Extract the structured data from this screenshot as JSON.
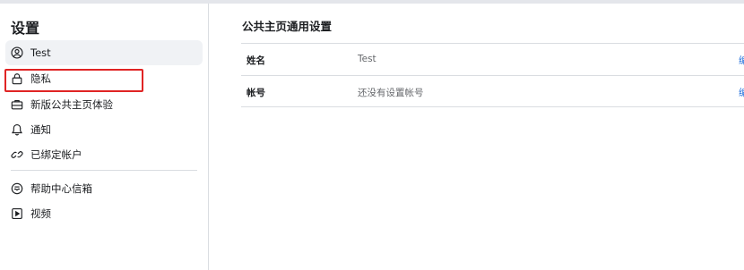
{
  "sidebar": {
    "title": "设置",
    "items": [
      {
        "label": "Test",
        "icon": "user-circle-icon"
      },
      {
        "label": "隐私",
        "icon": "lock-icon"
      },
      {
        "label": "新版公共主页体验",
        "icon": "briefcase-icon"
      },
      {
        "label": "通知",
        "icon": "bell-icon"
      },
      {
        "label": "已绑定帐户",
        "icon": "link-icon"
      },
      {
        "label": "帮助中心信箱",
        "icon": "inbox-icon"
      },
      {
        "label": "视频",
        "icon": "play-video-icon"
      }
    ]
  },
  "main": {
    "title": "公共主页通用设置",
    "rows": [
      {
        "label": "姓名",
        "value": "Test",
        "action": "编"
      },
      {
        "label": "帐号",
        "value": "还没有设置帐号",
        "action": "编"
      }
    ]
  },
  "colors": {
    "highlight": "#e02424",
    "link": "#216fdb",
    "active_bg": "#f0f2f5"
  }
}
